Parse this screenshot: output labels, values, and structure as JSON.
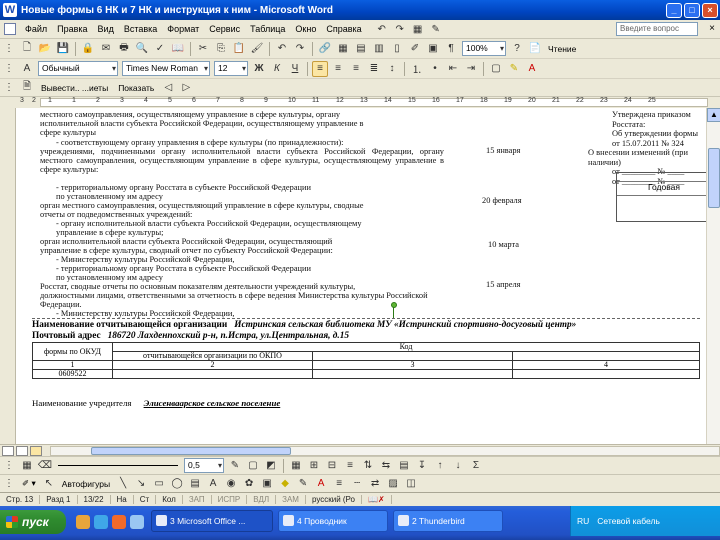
{
  "window": {
    "title": "Новые формы 6 НК и 7 НК и инструкция к ним - Microsoft Word"
  },
  "menu": {
    "items": [
      "Файл",
      "Правка",
      "Вид",
      "Вставка",
      "Формат",
      "Сервис",
      "Таблица",
      "Окно",
      "Справка"
    ],
    "help_placeholder": "Введите вопрос"
  },
  "formatting": {
    "style": "Обычный",
    "font": "Times New Roman",
    "size": "12",
    "zoom": "100%",
    "reading_mode": "Чтение"
  },
  "review": {
    "show_label": "Вывести.. ...иеты",
    "show_button": "Показать"
  },
  "ruler": {
    "marks": [
      "3",
      "2",
      "1",
      "1",
      "2",
      "3",
      "4",
      "5",
      "6",
      "7",
      "8",
      "9",
      "10",
      "11",
      "12",
      "13",
      "14",
      "15",
      "16",
      "17",
      "18",
      "19",
      "20",
      "21",
      "22",
      "23",
      "24",
      "25"
    ]
  },
  "document": {
    "paragraphs": [
      "местного самоуправления, осуществляющему управление в сфере культуры, органу",
      "исполнительной власти субъекта Российской Федерации, осуществляющему управление в",
      "сфере культуры",
      "- соответствующему органу управления в сфере культуры (по принадлежности):",
      "учреждениями, подчиненными органу исполнительной власти субъекта Российской Федерации, органу местного самоуправления, осуществляющим управление в сфере культуры, осуществляющему управление в сфере культуры:",
      "- территориальному органу Росстата в субъекте Российской Федерации",
      "  по установленному им адресу",
      "орган местного самоуправления, осуществляющий управление в сфере культуры, сводные",
      "отчеты от подведомственных учреждений:",
      "- органу исполнительной власти субъекта Российской Федерации, осуществляющему",
      "  управление в сфере культуры;",
      "орган исполнительной власти субъекта Российской Федерации, осуществляющий",
      "управление в сфере культуры, сводный отчет по субъекту Российской Федерации:",
      "- Министерству культуры Российской Федерации,",
      "- территориальному органу Росстата в субъекте Российской Федерации",
      "  по установленному им адресу",
      "Росстат, сводные отчеты по основным показателям деятельности учреждений культуры,",
      "должностными лицами, ответственными за отчетность в сфере ведения Министерства культуры Российской",
      "Федерации.",
      "- Министерству культуры Российской Федерации,"
    ],
    "dates": [
      "15 января",
      "20 февраля",
      "10 марта",
      "15 апреля"
    ],
    "right_header": [
      "Утверждена приказом Росстата:",
      "Об утверждении формы",
      "от 15.07.2011 № 324",
      "О внесении изменений (при наличии)",
      "от ________ № ____",
      "от ________ № ____"
    ],
    "annual_label": "Годовая",
    "org_label": "Наименование отчитывающейся организации",
    "org_value": "Истринская сельская библиотека МУ «Истринский спортивно-досуговый центр»",
    "address_label": "Почтовый адрес",
    "address_value": "186720 Лахденпохский р-н, п.Истра, ул.Центральная, д.15",
    "table": {
      "code_header": "Код",
      "form_code_label": "формы по ОКУД",
      "org_code_label": "отчитывающейся организации по ОКПО",
      "col_numbers": [
        "1",
        "2",
        "3",
        "4"
      ],
      "okud_value": "0609522"
    },
    "founder_label": "Наименование учредителя",
    "founder_value": "Элисенваарское сельское поселение"
  },
  "drawing": {
    "line_width": "0,5",
    "autoshapes": "Автофигуры"
  },
  "status": {
    "items": [
      "Стр. 13",
      "Разд 1",
      "13/22",
      "На",
      "Ст",
      "Кол",
      "ЗАП",
      "ИСПР",
      "ВДЛ",
      "ЗАМ",
      "русский (Ро"
    ]
  },
  "taskbar": {
    "start": "пуск",
    "tasks": [
      "3 Microsoft Office ...",
      "4 Проводник",
      "2 Thunderbird"
    ],
    "tray_lang": "RU",
    "tray_text": "Сетевой кабель"
  }
}
